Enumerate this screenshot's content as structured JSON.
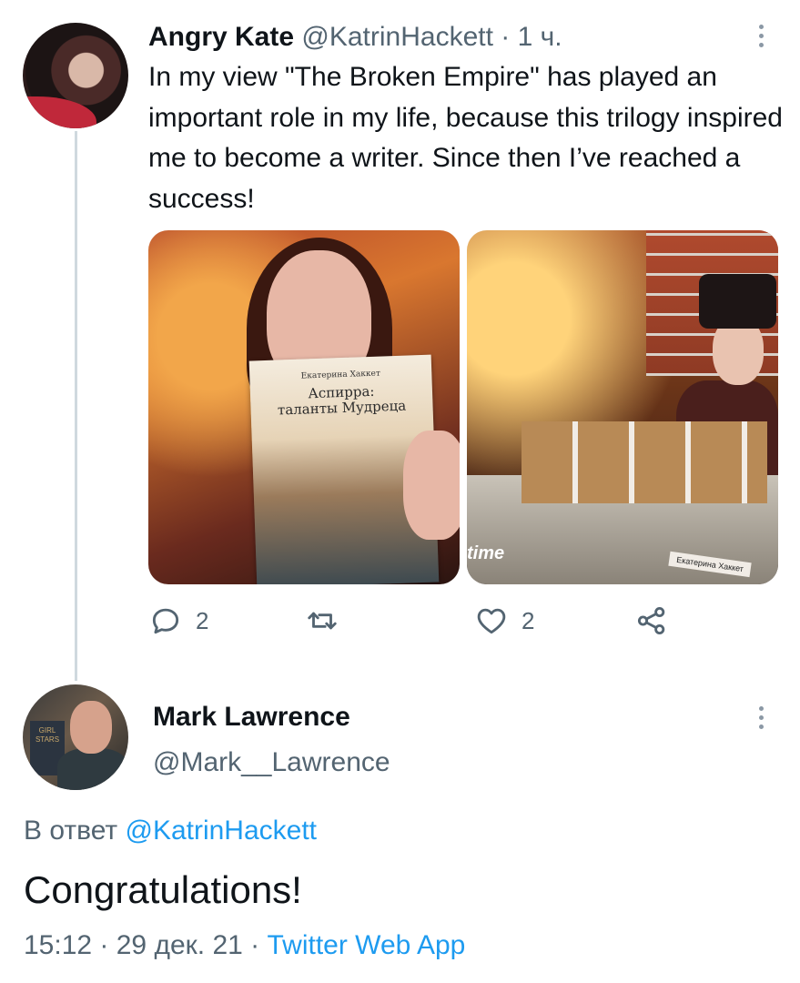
{
  "tweet": {
    "display_name": "Angry Kate",
    "handle": "@KatrinHackett",
    "separator": " · ",
    "time": "1 ч.",
    "text": "In my view \"The Broken Empire\" has played an important role in my life, because this trilogy inspired me to become a writer. Since then I’ve reached a success!",
    "media": [
      {
        "book_author": "Екатерина Хаккет",
        "book_title_line1": "Аспирра:",
        "book_title_line2": "таланты Мудреца"
      },
      {
        "overlay_text": "time",
        "badge_text": "Екатерина Хаккет"
      }
    ],
    "actions": {
      "reply_count": "2",
      "like_count": "2"
    }
  },
  "reply": {
    "display_name": "Mark Lawrence",
    "handle": "@Mark__Lawrence",
    "avatar_book_text": "GIRL STARS",
    "reply_prefix": "В ответ ",
    "reply_to_handle": "@KatrinHackett",
    "text": "Congratulations!",
    "time": "15:12",
    "date": "29 дек. 21",
    "meta_separator": " · ",
    "source": "Twitter Web App"
  },
  "colors": {
    "link": "#1d9bf0",
    "muted": "#536471",
    "text": "#0f1419"
  }
}
